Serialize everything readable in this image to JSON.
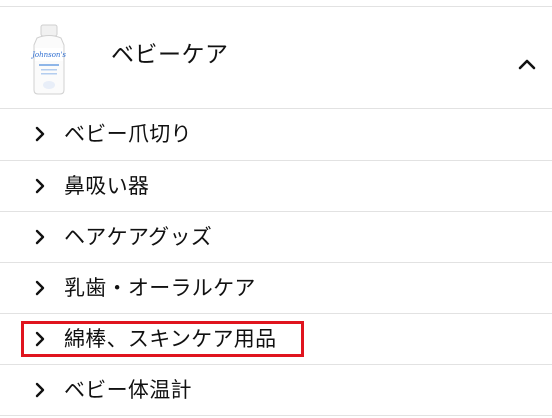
{
  "category": {
    "title": "ベビーケア",
    "thumbnail_icon": "baby-lotion-bottle-icon",
    "thumbnail_brand_text": "Johnson's",
    "toggle_icon": "chevron-up-icon",
    "expanded": true
  },
  "subcategories": [
    {
      "label": "ベビー爪切り"
    },
    {
      "label": "鼻吸い器"
    },
    {
      "label": "ヘアケアグッズ"
    },
    {
      "label": "乳歯・オーラルケア"
    },
    {
      "label": "綿棒、スキンケア用品",
      "highlighted": true
    },
    {
      "label": "ベビー体温計"
    }
  ],
  "item_icon": "chevron-right-icon",
  "colors": {
    "text": "#111111",
    "divider": "#e2e2e2",
    "highlight": "#e0141e",
    "background": "#ffffff"
  }
}
